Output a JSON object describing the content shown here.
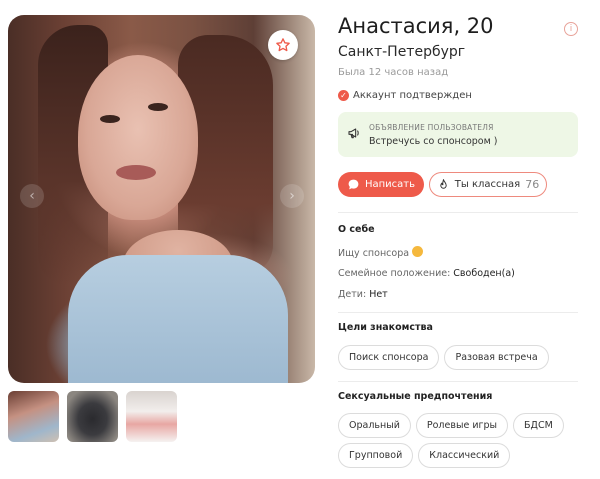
{
  "profile": {
    "name_age": "Анастасия, 20",
    "city": "Санкт-Петербург",
    "last_seen": "Была 12 часов назад",
    "verified": "Аккаунт подтвержден"
  },
  "announcement": {
    "caption": "ОБЪЯВЛЕНИЕ ПОЛЬЗОВАТЕЛЯ",
    "text": "Встречусь со спонсором )"
  },
  "actions": {
    "write_label": "Написать",
    "like_label": "Ты классная",
    "like_count": "76"
  },
  "about": {
    "title": "О себе",
    "looking_for": "Ищу спонсора",
    "family_label": "Семейное положение:",
    "family_value": "Свободен(а)",
    "kids_label": "Дети:",
    "kids_value": "Нет"
  },
  "goals": {
    "title": "Цели знакомства",
    "items": [
      "Поиск спонсора",
      "Разовая встреча"
    ]
  },
  "preferences": {
    "title": "Сексуальные предпочтения",
    "items": [
      "Оральный",
      "Ролевые игры",
      "БДСМ",
      "Групповой",
      "Классический"
    ]
  },
  "photos": {
    "thumb_count": 3,
    "prev_arrow": "‹",
    "next_arrow": "›"
  },
  "colors": {
    "accent": "#ee5a4a",
    "announce_bg": "#eef7e6"
  },
  "icons": {
    "favorite": "star-icon",
    "info": "info-icon",
    "verified": "check-icon",
    "announcement": "megaphone-icon",
    "write": "chat-icon",
    "like": "flame-icon"
  }
}
